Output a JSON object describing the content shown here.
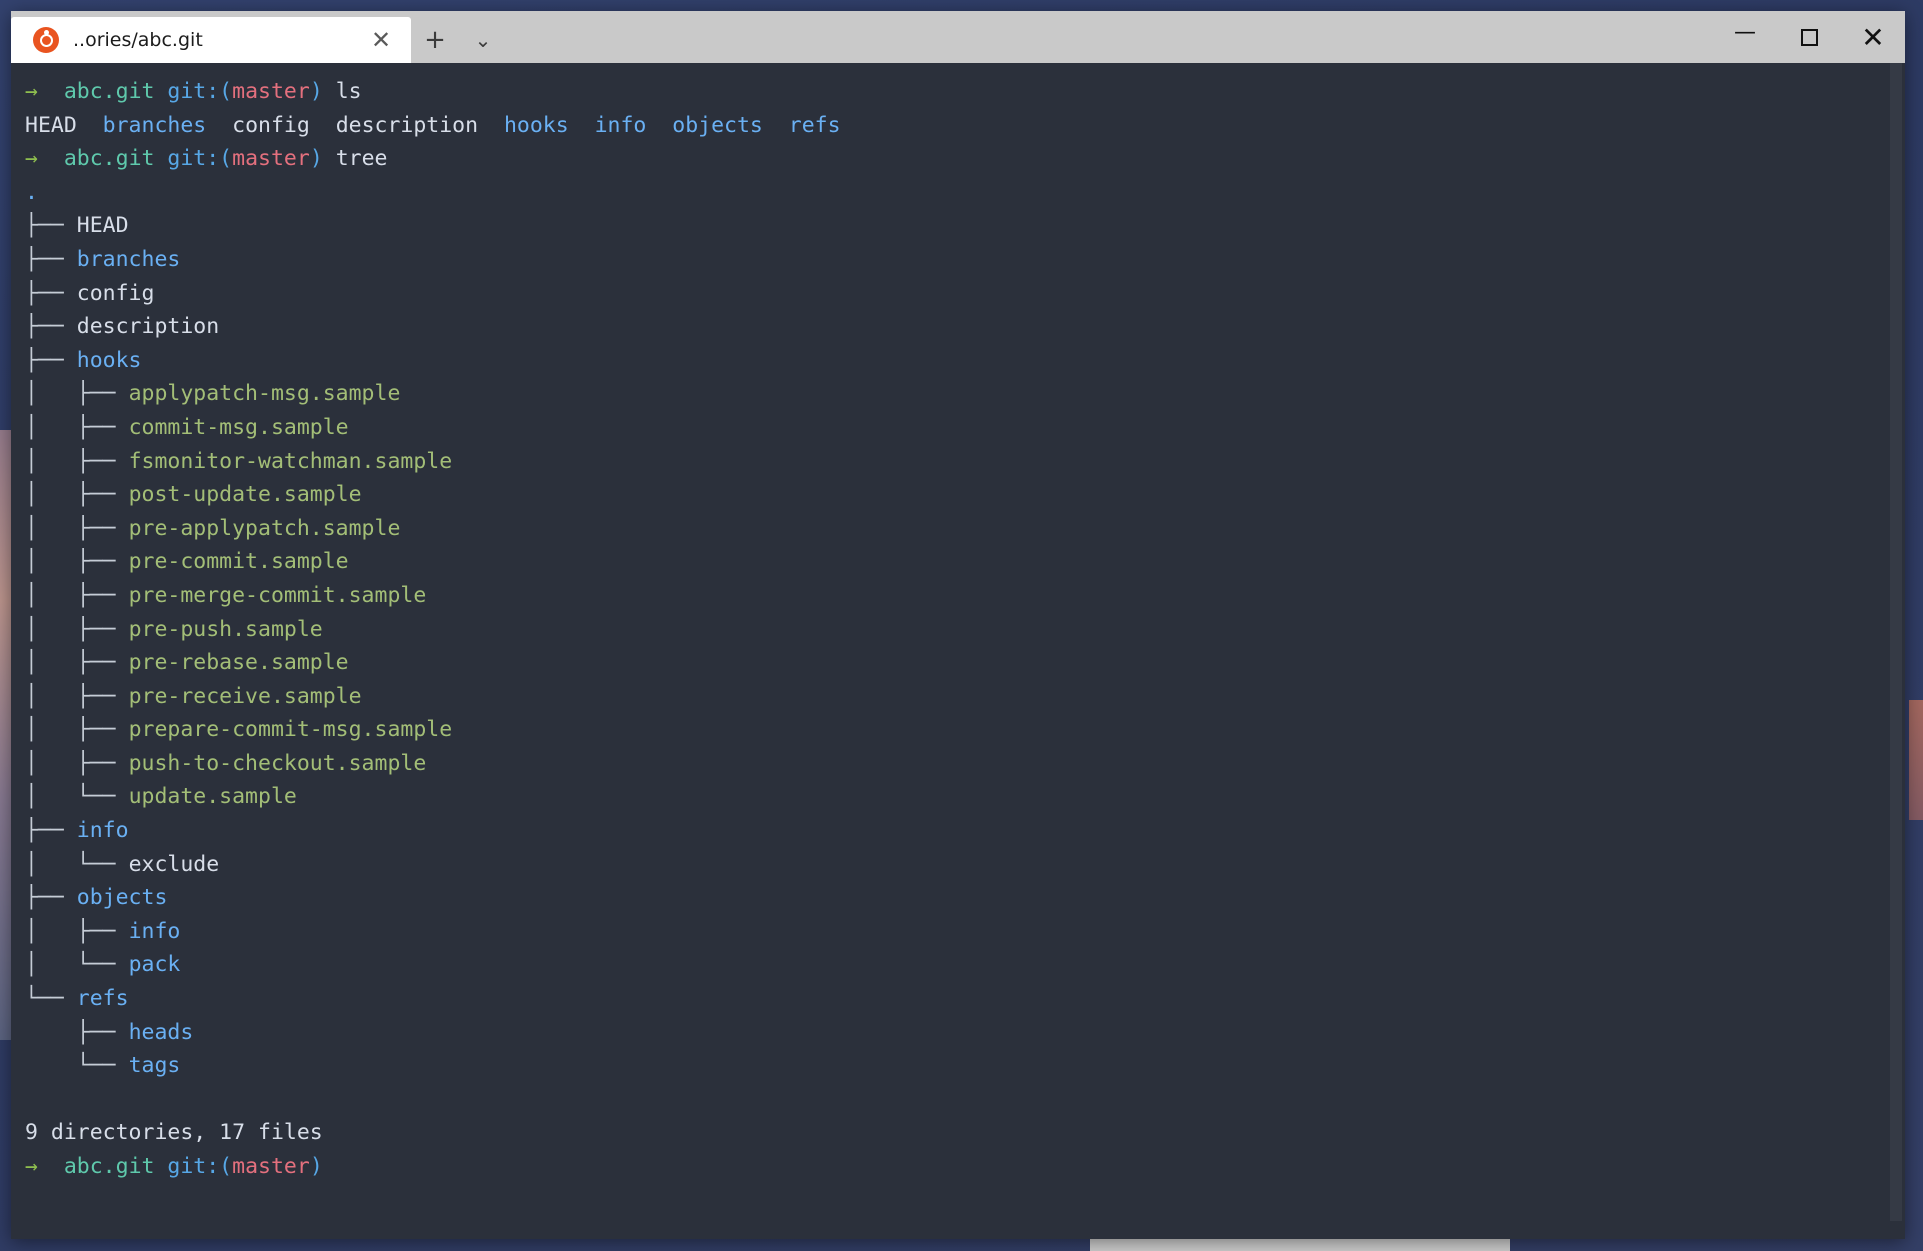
{
  "window": {
    "tab": {
      "title": "..ories/abc.git",
      "icon": "ubuntu-logo-icon",
      "close_label": "✕"
    },
    "new_tab_label": "+",
    "dropdown_label": "⌄",
    "controls": {
      "minimize_label": "—",
      "maximize_label": "",
      "close_label": "✕"
    }
  },
  "colors": {
    "terminal_background": "#2b303b",
    "titlebar_background": "#c9c9c9",
    "tab_active_background": "#ffffff",
    "text_white": "#d8dee9",
    "directory_blue": "#6ab0f3",
    "executable_green": "#a3be77",
    "prompt_arrow_green": "#8fbf4f",
    "prompt_path_cyan": "#5fc9ac",
    "prompt_git_blue": "#57a7e6",
    "prompt_branch_red": "#e4707e",
    "tree_lines": "#c5ccd6",
    "ubuntu_orange": "#e95420"
  },
  "terminal": {
    "prompt": {
      "arrow": "→",
      "path": "abc.git",
      "git_prefix": "git:(",
      "branch": "master",
      "git_suffix": ")"
    },
    "commands": {
      "ls": "ls",
      "tree": "tree"
    },
    "ls_output": [
      {
        "name": "HEAD",
        "type": "file"
      },
      {
        "name": "branches",
        "type": "dir"
      },
      {
        "name": "config",
        "type": "file"
      },
      {
        "name": "description",
        "type": "file"
      },
      {
        "name": "hooks",
        "type": "dir"
      },
      {
        "name": "info",
        "type": "dir"
      },
      {
        "name": "objects",
        "type": "dir"
      },
      {
        "name": "refs",
        "type": "dir"
      }
    ],
    "tree_root": ".",
    "tree_rows": [
      {
        "prefix": "├── ",
        "name": "HEAD",
        "type": "file",
        "depth": 0
      },
      {
        "prefix": "├── ",
        "name": "branches",
        "type": "dir",
        "depth": 0
      },
      {
        "prefix": "├── ",
        "name": "config",
        "type": "file",
        "depth": 0
      },
      {
        "prefix": "├── ",
        "name": "description",
        "type": "file",
        "depth": 0
      },
      {
        "prefix": "├── ",
        "name": "hooks",
        "type": "dir",
        "depth": 0
      },
      {
        "prefix": "│   ├── ",
        "name": "applypatch-msg.sample",
        "type": "exec",
        "depth": 1
      },
      {
        "prefix": "│   ├── ",
        "name": "commit-msg.sample",
        "type": "exec",
        "depth": 1
      },
      {
        "prefix": "│   ├── ",
        "name": "fsmonitor-watchman.sample",
        "type": "exec",
        "depth": 1
      },
      {
        "prefix": "│   ├── ",
        "name": "post-update.sample",
        "type": "exec",
        "depth": 1
      },
      {
        "prefix": "│   ├── ",
        "name": "pre-applypatch.sample",
        "type": "exec",
        "depth": 1
      },
      {
        "prefix": "│   ├── ",
        "name": "pre-commit.sample",
        "type": "exec",
        "depth": 1
      },
      {
        "prefix": "│   ├── ",
        "name": "pre-merge-commit.sample",
        "type": "exec",
        "depth": 1
      },
      {
        "prefix": "│   ├── ",
        "name": "pre-push.sample",
        "type": "exec",
        "depth": 1
      },
      {
        "prefix": "│   ├── ",
        "name": "pre-rebase.sample",
        "type": "exec",
        "depth": 1
      },
      {
        "prefix": "│   ├── ",
        "name": "pre-receive.sample",
        "type": "exec",
        "depth": 1
      },
      {
        "prefix": "│   ├── ",
        "name": "prepare-commit-msg.sample",
        "type": "exec",
        "depth": 1
      },
      {
        "prefix": "│   ├── ",
        "name": "push-to-checkout.sample",
        "type": "exec",
        "depth": 1
      },
      {
        "prefix": "│   └── ",
        "name": "update.sample",
        "type": "exec",
        "depth": 1
      },
      {
        "prefix": "├── ",
        "name": "info",
        "type": "dir",
        "depth": 0
      },
      {
        "prefix": "│   └── ",
        "name": "exclude",
        "type": "file",
        "depth": 1
      },
      {
        "prefix": "├── ",
        "name": "objects",
        "type": "dir",
        "depth": 0
      },
      {
        "prefix": "│   ├── ",
        "name": "info",
        "type": "dir",
        "depth": 1
      },
      {
        "prefix": "│   └── ",
        "name": "pack",
        "type": "dir",
        "depth": 1
      },
      {
        "prefix": "└── ",
        "name": "refs",
        "type": "dir",
        "depth": 0
      },
      {
        "prefix": "    ├── ",
        "name": "heads",
        "type": "dir",
        "depth": 1
      },
      {
        "prefix": "    └── ",
        "name": "tags",
        "type": "dir",
        "depth": 1
      }
    ],
    "summary": "9 directories, 17 files"
  }
}
